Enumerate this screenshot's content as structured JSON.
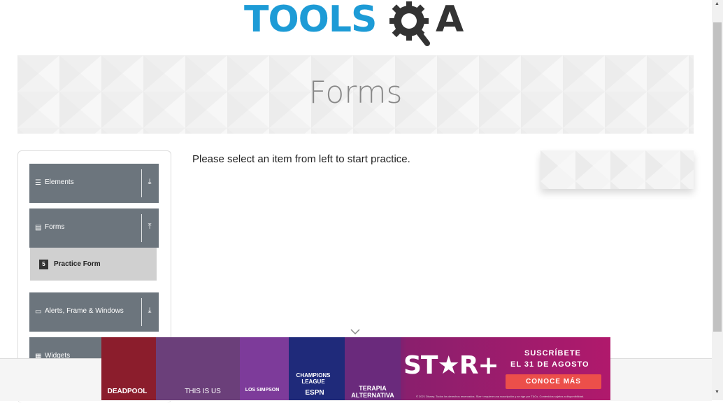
{
  "header": {
    "logo_text_left": "TOOLS",
    "logo_text_right": "A"
  },
  "banner": {
    "title": "Forms"
  },
  "sidebar": {
    "groups": [
      {
        "label": "Elements",
        "icon": "hamburger-icon",
        "arrow": "download-arrow-icon"
      },
      {
        "label": "Forms",
        "icon": "document-icon",
        "arrow": "upload-arrow-icon"
      },
      {
        "label": "Alerts, Frame & Windows",
        "icon": "window-icon",
        "arrow": "download-arrow-icon"
      },
      {
        "label": "Widgets",
        "icon": "grid-icon",
        "arrow": "download-arrow-icon"
      }
    ],
    "forms_items": [
      {
        "label": "Practice Form",
        "icon": "html5-icon",
        "icon_text": "5"
      }
    ]
  },
  "main": {
    "message": "Please select an item from left to start practice."
  },
  "ad": {
    "panels": [
      "DEADPOOL",
      "THIS IS US",
      "LOS SIMPSON",
      "CHAMPIONS LEAGUE",
      "ESPN",
      "TERAPIA ALTERNATIVA"
    ],
    "brand": "ST★R+",
    "line1": "SUSCRÍBETE",
    "line2": "EL 31 DE AGOSTO",
    "cta": "CONOCE MÁS",
    "fine_print": "© 2021 Disney. Todos los derechos reservados. Star+ requiere una suscripción y se rige por T&Cs. Contenidos sujetos a disponibilidad."
  },
  "colors": {
    "logo_blue": "#1d9bd6",
    "logo_dark": "#333333",
    "group_bg": "#6c757d",
    "active_item_bg": "#d0d0d0",
    "cta_red": "#ec4f4a"
  }
}
